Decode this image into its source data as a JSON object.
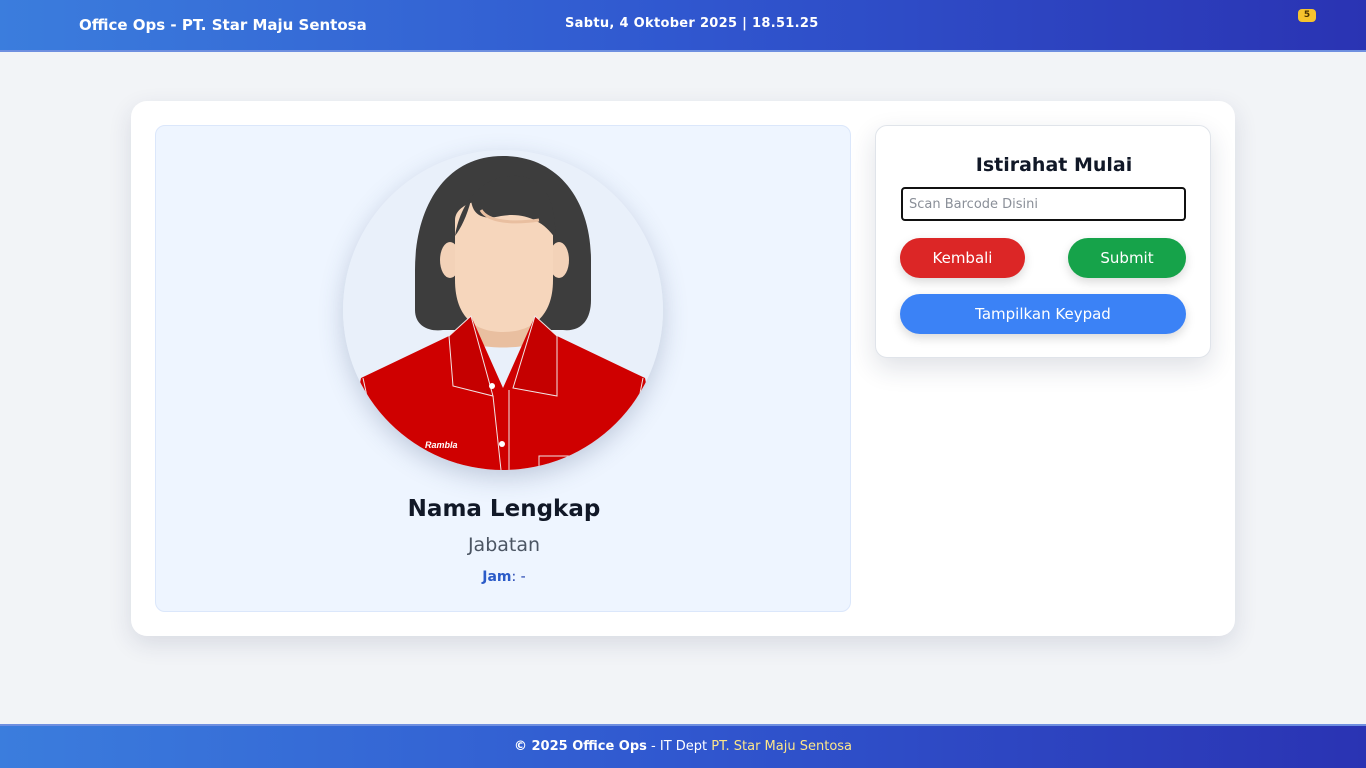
{
  "header": {
    "brand": "Office Ops - PT. Star Maju Sentosa",
    "datetime": "Sabtu, 4 Oktober 2025 | 18.51.25",
    "notification_count": "5"
  },
  "profile": {
    "name": "Nama Lengkap",
    "role": "Jabatan",
    "time_label": "Jam",
    "time_value": "-",
    "shirt_logo": "Rambla"
  },
  "scan": {
    "title": "Istirahat Mulai",
    "input_placeholder": "Scan Barcode Disini",
    "input_value": "",
    "back_label": "Kembali",
    "submit_label": "Submit",
    "keypad_label": "Tampilkan Keypad"
  },
  "footer": {
    "copyright": "© 2025 Office Ops",
    "separator": " - IT Dept ",
    "company": "PT. Star Maju Sentosa"
  },
  "colors": {
    "header_gradient_start": "#3b7ddd",
    "header_gradient_end": "#2a33b3",
    "back_button": "#dc2626",
    "submit_button": "#16a34a",
    "keypad_button": "#3b82f6",
    "badge": "#f6c32d"
  }
}
